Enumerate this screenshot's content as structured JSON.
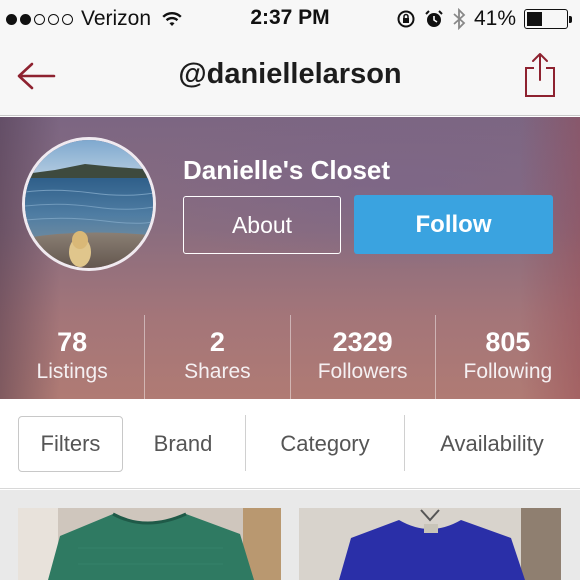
{
  "status_bar": {
    "carrier": "Verizon",
    "time": "2:37 PM",
    "battery_percent": "41%",
    "battery_level": 0.41,
    "signal_bars_filled": 2,
    "signal_bars_total": 5,
    "icons": [
      "wifi-icon",
      "orientation-lock-icon",
      "alarm-icon",
      "bluetooth-icon",
      "battery-icon"
    ]
  },
  "nav": {
    "title": "@daniellelarson",
    "back_icon": "back-arrow-icon",
    "share_icon": "share-icon"
  },
  "profile": {
    "closet_name": "Danielle's Closet",
    "about_label": "About",
    "follow_label": "Follow",
    "stats": [
      {
        "value": "78",
        "label": "Listings"
      },
      {
        "value": "2",
        "label": "Shares"
      },
      {
        "value": "2329",
        "label": "Followers"
      },
      {
        "value": "805",
        "label": "Following"
      }
    ]
  },
  "filters": {
    "filters_label": "Filters",
    "items": [
      "Brand",
      "Category",
      "Availability"
    ]
  },
  "colors": {
    "accent_red": "#8e2230",
    "follow_blue": "#3aa3e0"
  }
}
